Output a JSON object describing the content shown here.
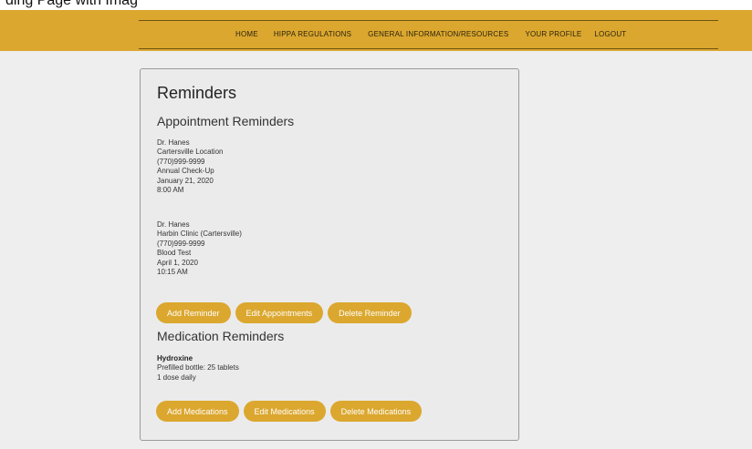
{
  "caption": "ding Page with Imag",
  "nav": {
    "items": [
      "HOME",
      "HIPPA REGULATIONS",
      "GENERAL INFORMATION/RESOURCES",
      "YOUR PROFILE",
      "LOGOUT"
    ]
  },
  "colors": {
    "accent": "#dba72e",
    "page_bg": "#eeeeee",
    "card_bg": "#ebebeb"
  },
  "card": {
    "title": "Reminders",
    "appointments": {
      "heading": "Appointment Reminders",
      "items": [
        {
          "doctor": "Dr. Hanes",
          "location": "Cartersville Location",
          "phone": "(770)999-9999",
          "reason": "Annual Check-Up",
          "date": "January 21, 2020",
          "time": "8:00 AM"
        },
        {
          "doctor": "Dr. Hanes",
          "location": "Harbin Clinic (Cartersville)",
          "phone": "(770)999-9999",
          "reason": "Blood Test",
          "date": "April 1, 2020",
          "time": "10:15 AM"
        }
      ],
      "buttons": {
        "add": "Add Reminder",
        "edit": "Edit Appointments",
        "delete": "Delete Reminder"
      }
    },
    "medications": {
      "heading": "Medication Reminders",
      "items": [
        {
          "name": "Hydroxine",
          "detail": "Prefilled bottle: 25 tablets",
          "dose": "1 dose daily"
        }
      ],
      "buttons": {
        "add": "Add Medications",
        "edit": "Edit Medications",
        "delete": "Delete Medications"
      }
    }
  }
}
